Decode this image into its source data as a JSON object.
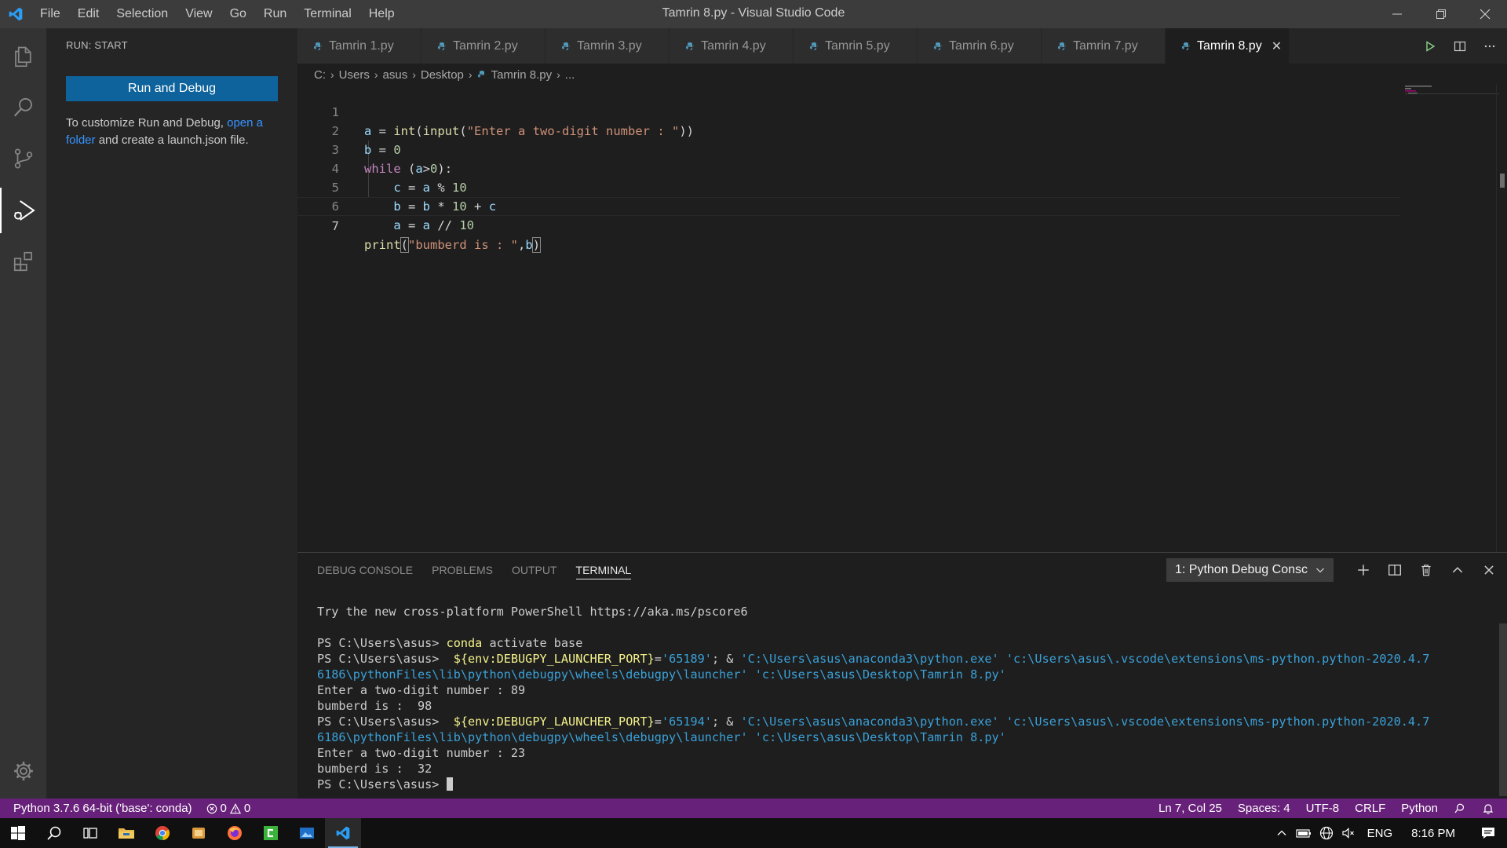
{
  "window": {
    "title": "Tamrin 8.py - Visual Studio Code"
  },
  "menu": {
    "items": [
      "File",
      "Edit",
      "Selection",
      "View",
      "Go",
      "Run",
      "Terminal",
      "Help"
    ]
  },
  "sidebar": {
    "title": "RUN: START",
    "run_button": "Run and Debug",
    "text_before": "To customize Run and Debug, ",
    "link": "open a folder",
    "text_after": " and create a launch.json file."
  },
  "tabs": [
    {
      "label": "Tamrin 1.py",
      "active": false
    },
    {
      "label": "Tamrin 2.py",
      "active": false
    },
    {
      "label": "Tamrin 3.py",
      "active": false
    },
    {
      "label": "Tamrin 4.py",
      "active": false
    },
    {
      "label": "Tamrin 5.py",
      "active": false
    },
    {
      "label": "Tamrin 6.py",
      "active": false
    },
    {
      "label": "Tamrin 7.py",
      "active": false
    },
    {
      "label": "Tamrin 8.py",
      "active": true
    }
  ],
  "breadcrumb": [
    "C:",
    "Users",
    "asus",
    "Desktop",
    "Tamrin 8.py",
    "..."
  ],
  "editor": {
    "line_numbers": [
      "1",
      "2",
      "3",
      "4",
      "5",
      "6",
      "7"
    ],
    "code_lines": [
      "a = int(input(\"Enter a two-digit number : \"))",
      "b = 0",
      "while (a>0):",
      "    c = a % 10",
      "    b = b * 10 + c",
      "    a = a // 10",
      "print(\"bumberd is : \",b)"
    ]
  },
  "panel": {
    "tabs": [
      "DEBUG CONSOLE",
      "PROBLEMS",
      "OUTPUT",
      "TERMINAL"
    ],
    "active_tab": "TERMINAL",
    "terminal_select": "1: Python Debug Consc",
    "terminal": {
      "pscore": "Try the new cross-platform PowerShell https://aka.ms/pscore6",
      "prompt": "PS C:\\Users\\asus>",
      "conda_cmd": "conda",
      "conda_args": " activate base",
      "env_var": "${env:DEBUGPY_LAUNCHER_PORT}",
      "port1": "'65189'",
      "port2": "'65194'",
      "amp": "; & ",
      "python_path": "'C:\\Users\\asus\\anaconda3\\python.exe'",
      "launcher_part1": "'c:\\Users\\asus\\.vscode\\extensions\\ms-python.python-2020.4.7",
      "launcher_part2": "6186\\pythonFiles\\lib\\python\\debugpy\\wheels\\debugpy\\launcher'",
      "script_path": "'c:\\Users\\asus\\Desktop\\Tamrin 8.py'",
      "input1": "Enter a two-digit number : 89",
      "output1": "bumberd is :  98",
      "input2": "Enter a two-digit number : 23",
      "output2": "bumberd is :  32"
    }
  },
  "statusbar": {
    "interpreter": "Python 3.7.6 64-bit ('base': conda)",
    "errors": "0",
    "warnings": "0",
    "position": "Ln 7, Col 25",
    "spaces": "Spaces: 4",
    "encoding": "UTF-8",
    "eol": "CRLF",
    "language": "Python"
  },
  "taskbar": {
    "language": "ENG",
    "time": "8:16 PM"
  },
  "colors": {
    "statusbar": "#68217a",
    "accent_button": "#0e639c",
    "link": "#3794ff",
    "python_icon": "#519aba"
  }
}
